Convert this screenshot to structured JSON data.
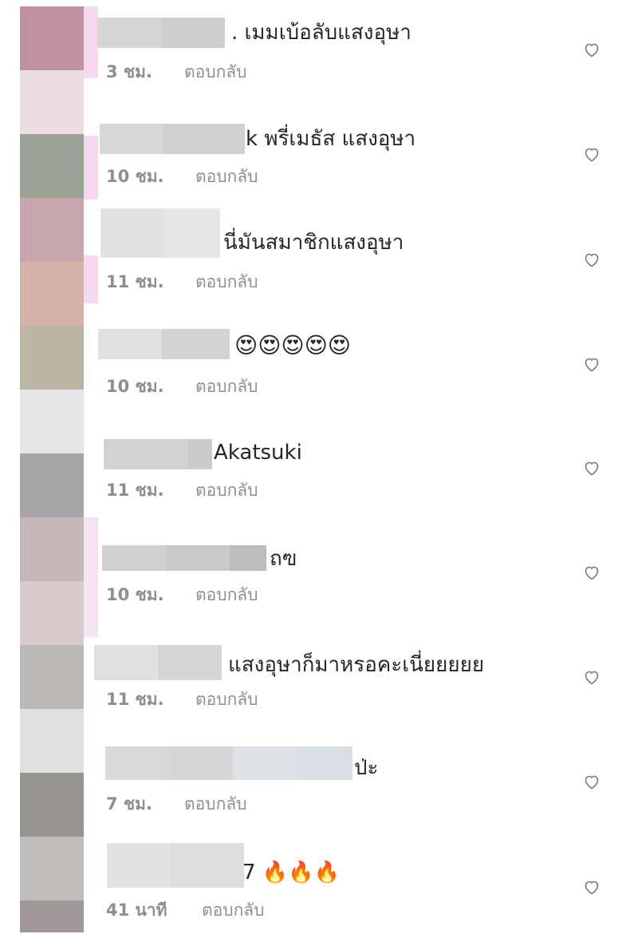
{
  "comments": [
    {
      "text": ". เมมเบ้อลับแสงอุษา",
      "time": "3 ชม.",
      "reply": "ตอบกลับ"
    },
    {
      "text": "k พรี่เมธัส แสงอุษา",
      "time": "10 ชม.",
      "reply": "ตอบกลับ"
    },
    {
      "text": "นี่มันสมาชิกแสงอุษา",
      "time": "11 ชม.",
      "reply": "ตอบกลับ"
    },
    {
      "text": "😍😍😍😍😍",
      "time": "10 ชม.",
      "reply": "ตอบกลับ"
    },
    {
      "text": "Akatsuki",
      "time": "11 ชม.",
      "reply": "ตอบกลับ"
    },
    {
      "text": "ถฃ",
      "time": "10 ชม.",
      "reply": "ตอบกลับ"
    },
    {
      "text": "แสงอุษาก็มาหรอคะเนี่ยยยยย",
      "time": "11 ชม.",
      "reply": "ตอบกลับ"
    },
    {
      "text": "ป่ะ",
      "time": "7 ชม.",
      "reply": "ตอบกลับ"
    },
    {
      "text": "7 🔥🔥🔥",
      "time": "41 นาที",
      "reply": "ตอบกลับ"
    }
  ],
  "icons": {
    "like": "heart-outline-icon"
  }
}
